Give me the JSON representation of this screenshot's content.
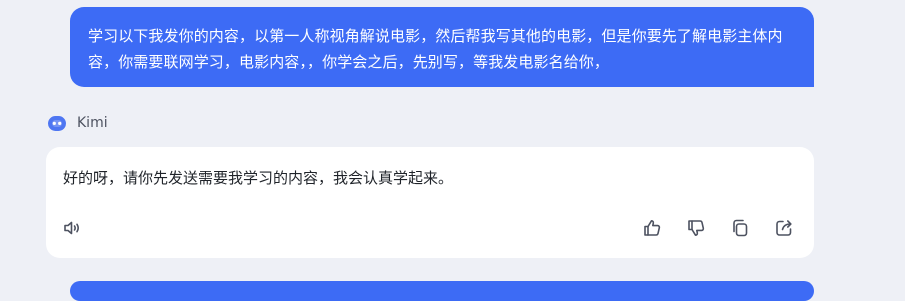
{
  "conversation": {
    "user_message": {
      "text": "学习以下我发你的内容，以第一人称视角解说电影，然后帮我写其他的电影，但是你要先了解电影主体内容，你需要联网学习，电影内容，，你学会之后，先别写，等我发电影名给你，"
    },
    "assistant": {
      "name": "Kimi",
      "avatar_icon": "kimi-bot-icon",
      "reply_text": "好的呀，请你先发送需要我学习的内容，我会认真学起来。",
      "actions": [
        {
          "name": "read-aloud",
          "icon": "speaker-icon"
        },
        {
          "name": "like",
          "icon": "thumbs-up-icon"
        },
        {
          "name": "dislike",
          "icon": "thumbs-down-icon"
        },
        {
          "name": "copy",
          "icon": "copy-icon"
        },
        {
          "name": "share",
          "icon": "share-icon"
        }
      ]
    }
  },
  "colors": {
    "background": "#eef0f6",
    "user_bubble": "#3d6bf5",
    "card": "#ffffff",
    "icon": "#4d5260"
  }
}
